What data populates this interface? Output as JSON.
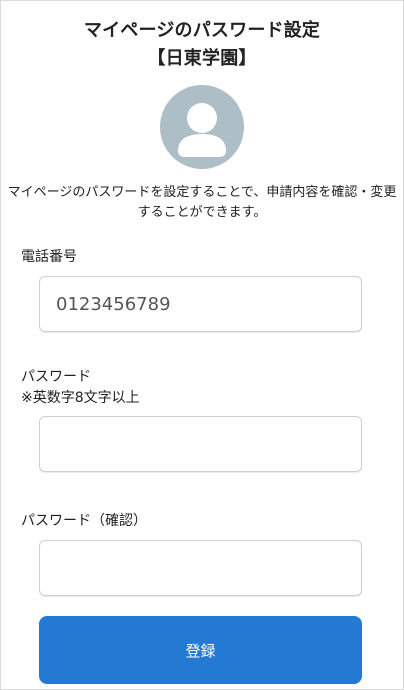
{
  "header": {
    "title_line1": "マイページのパスワード設定",
    "title_line2": "【日東学園】"
  },
  "avatar": {
    "icon": "user-avatar-icon",
    "color": "#aebec6"
  },
  "intro": {
    "text": "マイページのパスワードを設定することで、申請内容を確認・変更することができます。"
  },
  "form": {
    "phone": {
      "label": "電話番号",
      "value": "0123456789",
      "placeholder": ""
    },
    "password": {
      "label": "パスワード",
      "note": "※英数字8文字以上",
      "value": "",
      "placeholder": ""
    },
    "password_confirm": {
      "label": "パスワード（確認）",
      "value": "",
      "placeholder": ""
    },
    "submit_label": "登録"
  },
  "colors": {
    "accent": "#2479d3",
    "avatar_bg": "#aebec6",
    "border": "#cfcfcf"
  }
}
